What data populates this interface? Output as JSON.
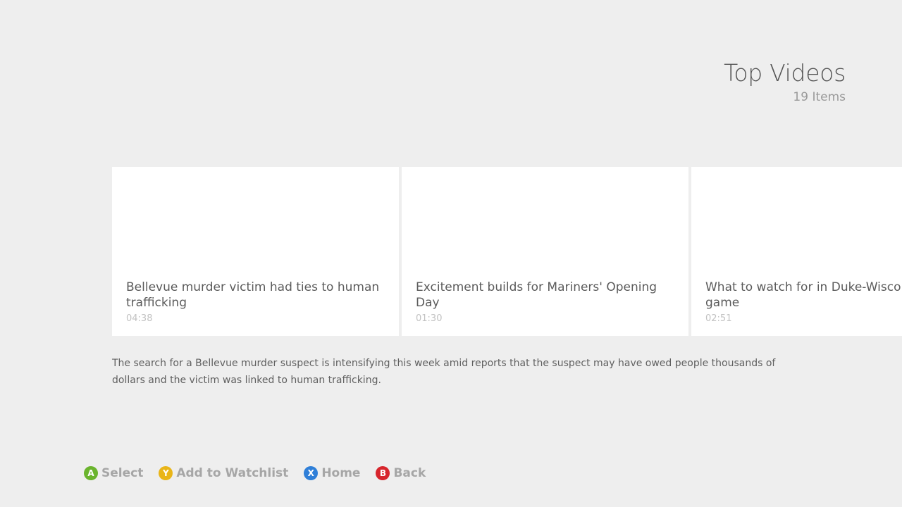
{
  "header": {
    "title": "Top Videos",
    "count": "19 Items"
  },
  "videos": [
    {
      "title": "Bellevue murder victim had ties to human trafficking",
      "duration": "04:38"
    },
    {
      "title": "Excitement builds for Mariners' Opening Day",
      "duration": "01:30"
    },
    {
      "title": "What to watch for in Duke-Wisconsin game",
      "duration": "02:51"
    }
  ],
  "description": "The search for a Bellevue murder suspect is intensifying this week amid reports that the suspect may have owed people thousands of dollars and the victim was linked to human trafficking.",
  "footer": {
    "hints": [
      {
        "button": "A",
        "label": "Select",
        "color": "#6ab42d",
        "icon": "a-button-icon"
      },
      {
        "button": "Y",
        "label": "Add to Watchlist",
        "color": "#e9b518",
        "icon": "y-button-icon"
      },
      {
        "button": "X",
        "label": "Home",
        "color": "#2f7fd8",
        "icon": "x-button-icon"
      },
      {
        "button": "B",
        "label": "Back",
        "color": "#d7252c",
        "icon": "b-button-icon"
      }
    ]
  }
}
